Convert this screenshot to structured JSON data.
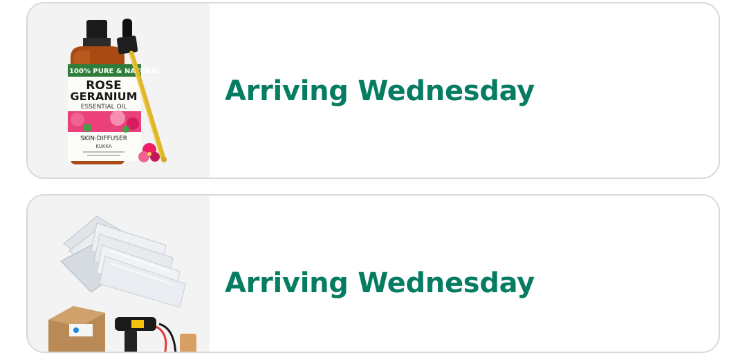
{
  "orders": [
    {
      "status": "Arriving Wednesday",
      "image": {
        "icon": "essential-oil-bottle-image",
        "label_top": "100% PURE & NATURAL",
        "name_line1": "ROSE",
        "name_line2": "GERANIUM",
        "sub": "ESSENTIAL OIL",
        "use": "SKIN·DIFFUSER",
        "brand": "KUKKA"
      }
    },
    {
      "status": "Arriving Wednesday",
      "image": {
        "icon": "shrink-wrap-bags-kit-image"
      }
    }
  ],
  "colors": {
    "status_green": "#067d62",
    "card_border": "#d5d9d9",
    "thumb_bg": "#f3f3f3"
  }
}
